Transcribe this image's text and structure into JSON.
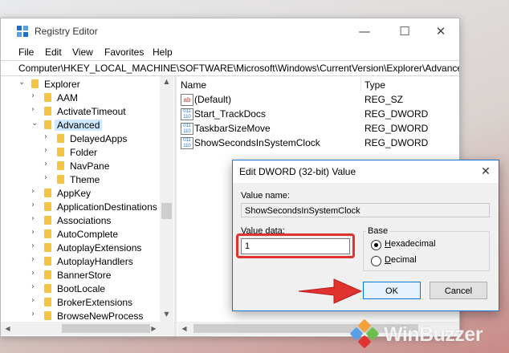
{
  "window": {
    "title": "Registry Editor",
    "controls": {
      "minimize": "—",
      "maximize": "☐",
      "close": "✕"
    }
  },
  "menu": [
    "File",
    "Edit",
    "View",
    "Favorites",
    "Help"
  ],
  "address": "Computer\\HKEY_LOCAL_MACHINE\\SOFTWARE\\Microsoft\\Windows\\CurrentVersion\\Explorer\\Advanced",
  "tree": [
    {
      "label": "Explorer",
      "level": 0,
      "expanded": true,
      "selected": false
    },
    {
      "label": "AAM",
      "level": 1,
      "expanded": false,
      "selected": false
    },
    {
      "label": "ActivateTimeout",
      "level": 1,
      "expanded": false,
      "selected": false
    },
    {
      "label": "Advanced",
      "level": 1,
      "expanded": true,
      "selected": true
    },
    {
      "label": "DelayedApps",
      "level": 2,
      "expanded": false,
      "selected": false
    },
    {
      "label": "Folder",
      "level": 2,
      "expanded": false,
      "selected": false
    },
    {
      "label": "NavPane",
      "level": 2,
      "expanded": false,
      "selected": false
    },
    {
      "label": "Theme",
      "level": 2,
      "expanded": false,
      "selected": false
    },
    {
      "label": "AppKey",
      "level": 1,
      "expanded": false,
      "selected": false
    },
    {
      "label": "ApplicationDestinations",
      "level": 1,
      "expanded": false,
      "selected": false
    },
    {
      "label": "Associations",
      "level": 1,
      "expanded": false,
      "selected": false
    },
    {
      "label": "AutoComplete",
      "level": 1,
      "expanded": false,
      "selected": false
    },
    {
      "label": "AutoplayExtensions",
      "level": 1,
      "expanded": false,
      "selected": false
    },
    {
      "label": "AutoplayHandlers",
      "level": 1,
      "expanded": false,
      "selected": false
    },
    {
      "label": "BannerStore",
      "level": 1,
      "expanded": false,
      "selected": false
    },
    {
      "label": "BootLocale",
      "level": 1,
      "expanded": false,
      "selected": false
    },
    {
      "label": "BrokerExtensions",
      "level": 1,
      "expanded": false,
      "selected": false
    },
    {
      "label": "BrowseNewProcess",
      "level": 1,
      "expanded": false,
      "selected": false
    }
  ],
  "list": {
    "columns": {
      "name": "Name",
      "type": "Type"
    },
    "rows": [
      {
        "icon": "string-value-icon",
        "icon_text": "ab",
        "name": "(Default)",
        "type": "REG_SZ"
      },
      {
        "icon": "binary-value-icon",
        "icon_text": "011 110",
        "name": "Start_TrackDocs",
        "type": "REG_DWORD"
      },
      {
        "icon": "binary-value-icon",
        "icon_text": "011 110",
        "name": "TaskbarSizeMove",
        "type": "REG_DWORD"
      },
      {
        "icon": "binary-value-icon",
        "icon_text": "011 110",
        "name": "ShowSecondsInSystemClock",
        "type": "REG_DWORD"
      }
    ]
  },
  "dialog": {
    "title": "Edit DWORD (32-bit) Value",
    "close": "✕",
    "value_name_label": "Value name:",
    "value_name": "ShowSecondsInSystemClock",
    "value_data_label": "Value data:",
    "value_data": "1",
    "base_label": "Base",
    "hex_label": "Hexadecimal",
    "dec_label": "Decimal",
    "selected_base": "hexadecimal",
    "ok_label": "OK",
    "cancel_label": "Cancel"
  },
  "watermark": "WinBuzzer",
  "colors": {
    "highlight": "#e0322e",
    "selection": "#cde8ff",
    "accent": "#1a73c9"
  }
}
